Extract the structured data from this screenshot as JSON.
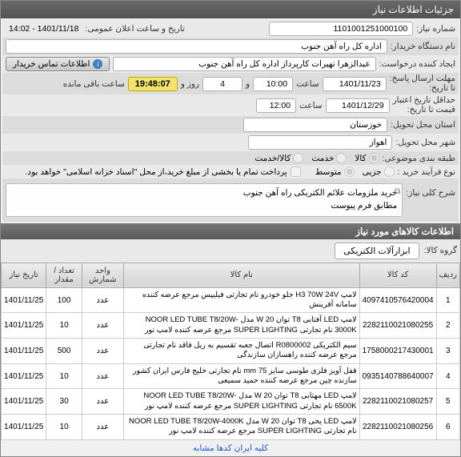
{
  "header": {
    "title": "جزئیات اطلاعات نیاز"
  },
  "fields": {
    "need_no_lbl": "شماره نیاز:",
    "need_no": "1101001251000100",
    "announce_lbl": "تاریخ و ساعت اعلان عمومی:",
    "announce": "1401/11/18 - 14:02",
    "buyer_lbl": "نام دستگاه خریدار:",
    "buyer": "اداره کل راه آهن جنوب",
    "requester_lbl": "ایجاد کننده درخواست:",
    "requester": "عبدالزهرا تهیرات کارپرداز اداره کل راه آهن جنوب",
    "contact_btn": "اطلاعات تماس خریدار",
    "deadline_lbl": "مهلت ارسال پاسخ:",
    "deadline_until": "تا تاریخ:",
    "deadline_date": "1401/11/23",
    "time_lbl": "ساعت",
    "deadline_time": "10:00",
    "and": "و",
    "days": "4",
    "days_lbl": "روز و",
    "timer": "19:48:07",
    "remain": "ساعت باقی مانده",
    "validity_lbl": "حداقل تاریخ اعتبار",
    "validity_sub": "قیمت تا تاریخ:",
    "validity_date": "1401/12/29",
    "validity_time": "12:00",
    "province_lbl": "استان محل تحویل:",
    "province": "خوزستان",
    "city_lbl": "شهر محل تحویل:",
    "city": "اهواز",
    "category_lbl": "طبقه بندی موضوعی:",
    "cat_goods": "کالا",
    "cat_service": "خدمت",
    "cat_both": "کالا/خدمت",
    "process_lbl": "نوع فرآیند خرید :",
    "proc_small": "جزیی",
    "proc_medium": "متوسط",
    "proc_check": "پرداخت تمام یا بخشی از مبلغ خرید،از محل \"اسناد خزانه اسلامی\" خواهد بود.",
    "desc_lbl": "شرح کلی نیاز:",
    "desc": "خرید ملزومات علائم الکتریکی راه آهن جنوب\nمطابق فرم پیوست"
  },
  "items_header": "اطلاعات کالاهای مورد نیاز",
  "group_lbl": "گروه کالا:",
  "group_val": "ابزارآلات الکتریکی",
  "table": {
    "cols": [
      "ردیف",
      "کد کالا",
      "نام کالا",
      "واحد شمارش",
      "تعداد / مقدار",
      "تاریخ نیاز"
    ],
    "rows": [
      {
        "r": "1",
        "code": "4097410576420004",
        "name": "لامپ H3 70W 24V جلو خودرو نام تجارتی فیلیپس مرجع عرضه کننده سامانه آفرینش",
        "unit": "عدد",
        "qty": "100",
        "date": "1401/11/25"
      },
      {
        "r": "2",
        "code": "2282110021080255",
        "name": "لامپ LED آفتابی T8 توان W 20 مدل NOOR LED TUBE T8/20W-3000K نام تجارتی SUPER LIGHTING مرجع عرضه کننده لامپ نور",
        "unit": "عدد",
        "qty": "10",
        "date": "1401/11/25"
      },
      {
        "r": "3",
        "code": "1758000217430001",
        "name": "سیم الکتریکی R0800002 اتصال جعبه تقسیم به ریل فاقد نام تجارتی مرجع عرضه کننده راهسازان سازندگی",
        "unit": "عدد",
        "qty": "500",
        "date": "1401/11/25"
      },
      {
        "r": "4",
        "code": "0935140788640007",
        "name": "قفل آویز فلزی طوسی سایز mm 75 نام تجارتی خلیج فارس ایران کشور سازنده چین مرجع عرضه کننده حمید سمیعی",
        "unit": "عدد",
        "qty": "10",
        "date": "1401/11/25"
      },
      {
        "r": "5",
        "code": "2282110021080257",
        "name": "لامپ LED مهتابی T8 توان W 20 مدل NOOR LED TUBE T8/20W-6500K نام تجارتی SUPER LIGHTING مرجع عرضه کننده لامپ نور",
        "unit": "عدد",
        "qty": "30",
        "date": "1401/11/25"
      },
      {
        "r": "6",
        "code": "2282110021080256",
        "name": "لامپ LED یخی T8 توان W 20 مدل NOOR LED TUBE T8/20W-4000K نام تجارتی SUPER LIGHTING مرجع عرضه کننده لامپ نور",
        "unit": "عدد",
        "qty": "10",
        "date": "1401/11/25"
      }
    ]
  },
  "footer": "کلیه ایران کدها مشابه"
}
